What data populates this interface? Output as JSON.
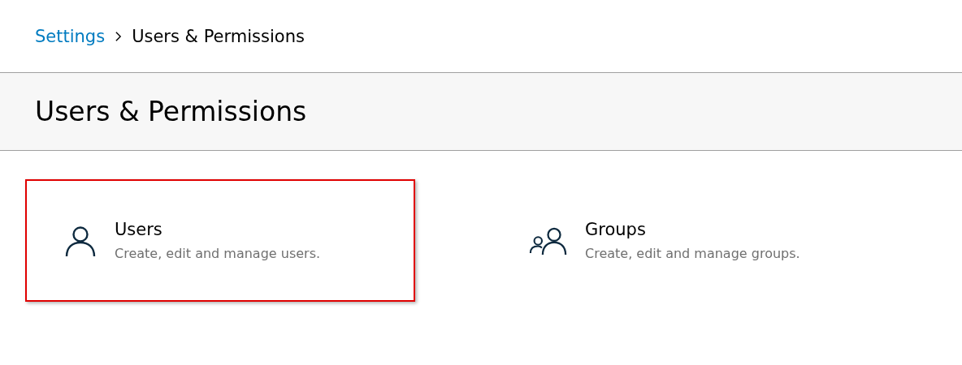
{
  "breadcrumb": [
    {
      "label": "Settings",
      "kind": "link"
    },
    {
      "label": "Users & Permissions",
      "kind": "current"
    }
  ],
  "page_title": "Users & Permissions",
  "cards": [
    {
      "kind": "user",
      "title": "Users",
      "description": "Create, edit and manage users.",
      "highlighted": true
    },
    {
      "kind": "group",
      "title": "Groups",
      "description": "Create, edit and manage groups.",
      "highlighted": false
    }
  ]
}
